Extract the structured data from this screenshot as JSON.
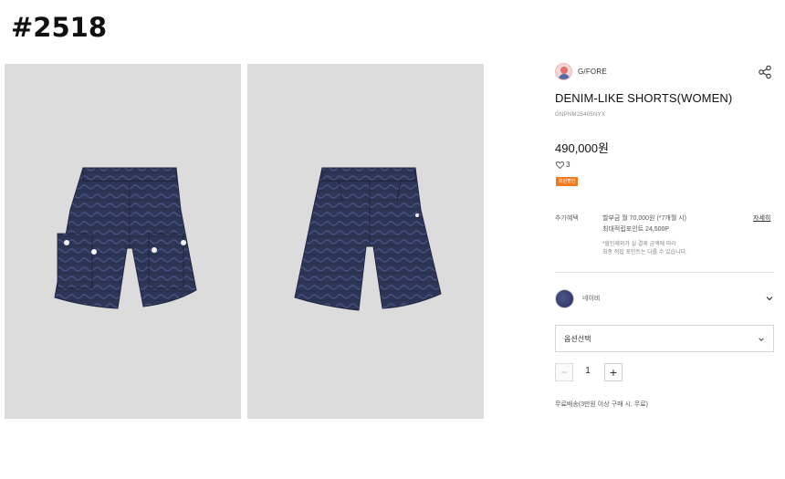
{
  "page_tag": "#2518",
  "brand": {
    "name": "G/FORE",
    "logo_icon": "brand-avatar-icon"
  },
  "product": {
    "title": "DENIM-LIKE SHORTS(WOMEN)",
    "code": "GNPNM25405NYX",
    "price": "490,000원",
    "likes": "3",
    "badge": "회원할인"
  },
  "benefits": {
    "label": "추가혜택",
    "line1": "할부금 월 70,000원 (*7개월 시)",
    "line2": "최대적립포인트 24,500P",
    "note1": "*할인제외가 실 결제 금액에 따라",
    "note2": "최종 적립 포인트는 다를 수 있습니다.",
    "detail_link": "자세히"
  },
  "color_option": {
    "name": "네이비",
    "swatch": "#333b6b"
  },
  "option_select": {
    "placeholder": "옵션선택"
  },
  "quantity": {
    "value": "1",
    "minus": "−",
    "plus": "+"
  },
  "shipping": "무료배송(3만원 이상 구매 시, 무료)",
  "colors": {
    "photo_bg": "#dcdcdc",
    "shorts": "#2d3559",
    "badge": "#f07a1e"
  }
}
